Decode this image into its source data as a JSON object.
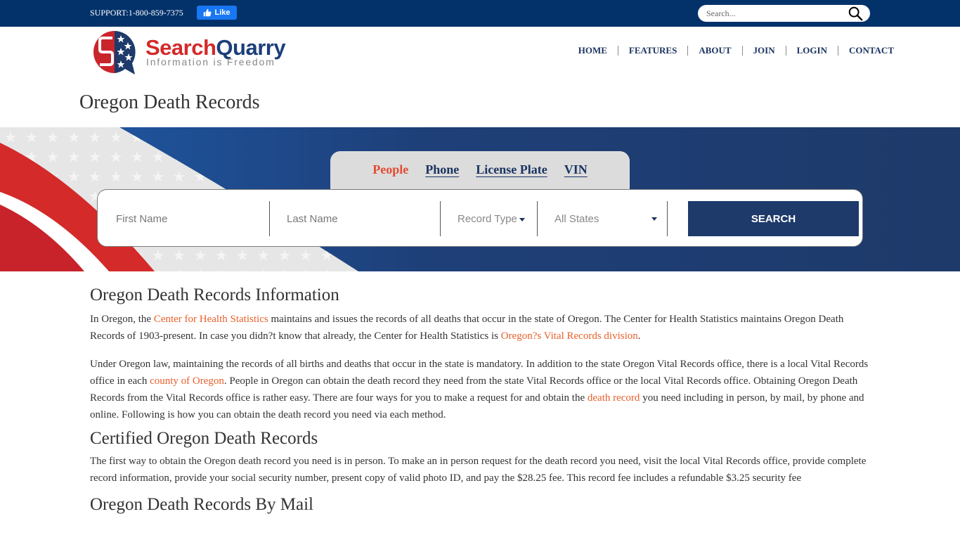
{
  "topbar": {
    "support_text": "SUPPORT:1-800-859-7375",
    "like_label": "Like",
    "search_placeholder": "Search..."
  },
  "logo": {
    "name_part1": "Search",
    "name_part2": "Quarry",
    "tagline": "Information is Freedom"
  },
  "nav": {
    "items": [
      "HOME",
      "FEATURES",
      "ABOUT",
      "JOIN",
      "LOGIN",
      "CONTACT"
    ]
  },
  "page_title": "Oregon Death Records",
  "search_panel": {
    "tabs": [
      {
        "label": "People",
        "active": true
      },
      {
        "label": "Phone",
        "active": false
      },
      {
        "label": "License Plate",
        "active": false
      },
      {
        "label": "VIN",
        "active": false
      }
    ],
    "first_name_placeholder": "First Name",
    "last_name_placeholder": "Last Name",
    "record_type_label": "Record Type",
    "state_label": "All States",
    "search_button": "SEARCH"
  },
  "colors": {
    "topbar": "#03326b",
    "navy": "#1e3a6a",
    "link_orange": "#e8602c",
    "active_tab_red": "#e34b33",
    "logo_red": "#d42a2a"
  },
  "article": {
    "h_info": "Oregon Death Records Information",
    "p1": {
      "t1": "In Oregon, the ",
      "link1": "Center for Health Statistics",
      "t2": " maintains and issues the records of all deaths that occur in the state of Oregon. The Center for Health Statistics maintains Oregon Death Records of 1903-present. In case you didn?t know that already, the Center for Health Statistics is ",
      "link2": "Oregon?s Vital Records division",
      "t3": "."
    },
    "p2": {
      "t1": "Under Oregon law, maintaining the records of all births and deaths that occur in the state is mandatory. In addition to the state Oregon Vital Records office, there is a local Vital Records office in each ",
      "link1": "county of Oregon",
      "t2": ". People in Oregon can obtain the death record they need from the state Vital Records office or the local Vital Records office. Obtaining Oregon Death Records from the Vital Records office is rather easy. There are four ways for you to make a request for and obtain the ",
      "link2": "death record",
      "t3": " you need including in person, by mail, by phone and online. Following is how you can obtain the death record you need via each method."
    },
    "h_cert": "Certified Oregon Death Records",
    "p3": "The first way to obtain the Oregon death record you need is in person. To make an in person request for the death record you need, visit the local Vital Records office, provide complete record information, provide your social security number, present copy of valid photo ID, and pay the $28.25 fee. This record fee includes a refundable $3.25 security fee",
    "h_mail": "Oregon Death Records By Mail"
  }
}
